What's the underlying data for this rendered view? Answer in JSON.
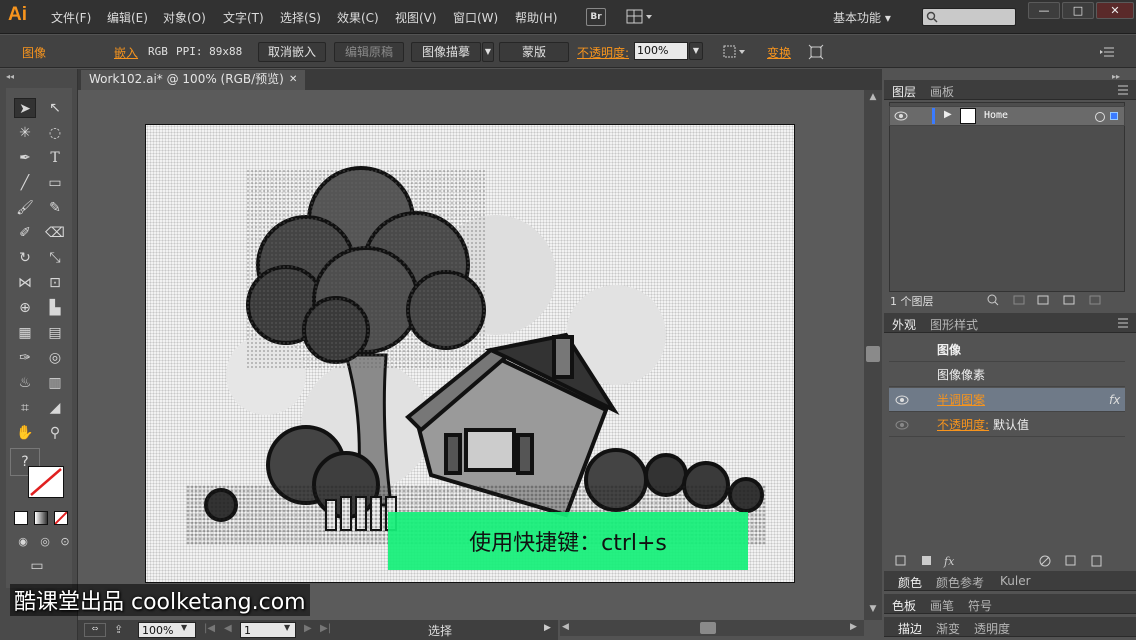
{
  "app": {
    "logo": "Ai"
  },
  "menu": [
    "文件(F)",
    "编辑(E)",
    "对象(O)",
    "文字(T)",
    "选择(S)",
    "效果(C)",
    "视图(V)",
    "窗口(W)",
    "帮助(H)"
  ],
  "bridge": "Br",
  "workspace": "基本功能",
  "window_buttons": [
    "—",
    "□",
    "✕"
  ],
  "control": {
    "selection_type": "图像",
    "embed": "嵌入",
    "colormode": "RGB",
    "ppi": "PPI: 89x88",
    "unembed": "取消嵌入",
    "edit_original": "编辑原稿",
    "image_trace": "图像描摹",
    "mask": "蒙版",
    "opacity_label": "不透明度:",
    "opacity_value": "100%",
    "transform": "变换"
  },
  "document": {
    "tab": "Work102.ai* @ 100% (RGB/预览)",
    "close": "✕"
  },
  "caption": "使用快捷键：ctrl+s",
  "watermark": "酷课堂出品 coolketang.com",
  "status": {
    "zoom": "100%",
    "page": "1",
    "mode": "选择"
  },
  "layers": {
    "tabs": [
      "图层",
      "画板"
    ],
    "row_name": "Home",
    "count": "1 个图层"
  },
  "appearance": {
    "tabs": [
      "外观",
      "图形样式"
    ],
    "title": "图像",
    "rows": [
      {
        "label": "图像像素",
        "value": ""
      },
      {
        "label": "半调图案",
        "value": "fx"
      },
      {
        "label": "不透明度:",
        "value": "默认值"
      }
    ]
  },
  "bottom_tabs": [
    [
      "颜色",
      "颜色参考",
      "Kuler"
    ],
    [
      "色板",
      "画笔",
      "符号"
    ],
    [
      "描边",
      "渐变",
      "透明度"
    ]
  ],
  "colors": {
    "accent": "#f7941d",
    "caption_bg": "#16f07a",
    "panel": "#535353"
  }
}
